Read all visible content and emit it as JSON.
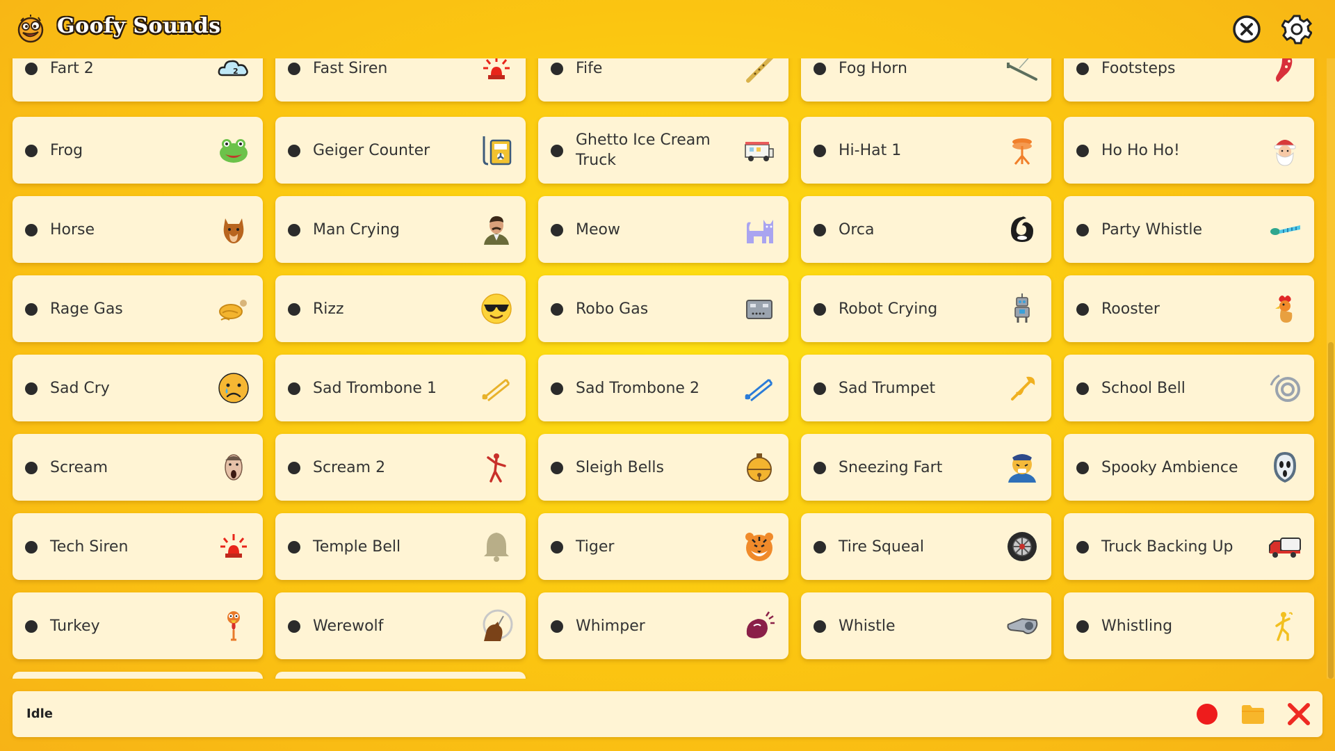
{
  "app": {
    "title": "Goofy Sounds"
  },
  "status": {
    "text": "Idle"
  },
  "sounds": [
    {
      "label": "Fart 2",
      "icon": "cloud-icon"
    },
    {
      "label": "Fast Siren",
      "icon": "siren-icon"
    },
    {
      "label": "Fife",
      "icon": "flute-icon"
    },
    {
      "label": "Fog Horn",
      "icon": "horn-icon"
    },
    {
      "label": "Footsteps",
      "icon": "footprint-icon"
    },
    {
      "label": "Frog",
      "icon": "frog-icon"
    },
    {
      "label": "Geiger Counter",
      "icon": "geiger-counter-icon"
    },
    {
      "label": "Ghetto Ice Cream Truck",
      "icon": "ice-cream-truck-icon"
    },
    {
      "label": "Hi-Hat 1",
      "icon": "hi-hat-icon"
    },
    {
      "label": "Ho Ho Ho!",
      "icon": "santa-icon"
    },
    {
      "label": "Horse",
      "icon": "horse-icon"
    },
    {
      "label": "Man Crying",
      "icon": "man-crying-icon"
    },
    {
      "label": "Meow",
      "icon": "cat-icon"
    },
    {
      "label": "Orca",
      "icon": "orca-icon"
    },
    {
      "label": "Party Whistle",
      "icon": "party-whistle-icon"
    },
    {
      "label": "Rage Gas",
      "icon": "rage-gas-icon"
    },
    {
      "label": "Rizz",
      "icon": "sunglasses-face-icon"
    },
    {
      "label": "Robo Gas",
      "icon": "robot-face-icon"
    },
    {
      "label": "Robot Crying",
      "icon": "robot-icon"
    },
    {
      "label": "Rooster",
      "icon": "rooster-icon"
    },
    {
      "label": "Sad Cry",
      "icon": "sad-face-icon"
    },
    {
      "label": "Sad Trombone 1",
      "icon": "trombone-icon"
    },
    {
      "label": "Sad Trombone 2",
      "icon": "trombone-blue-icon"
    },
    {
      "label": "Sad Trumpet",
      "icon": "trumpet-icon"
    },
    {
      "label": "School Bell",
      "icon": "bell-ring-icon"
    },
    {
      "label": "Scream",
      "icon": "screaming-face-icon"
    },
    {
      "label": "Scream 2",
      "icon": "scream-figure-icon"
    },
    {
      "label": "Sleigh Bells",
      "icon": "sleigh-bell-icon"
    },
    {
      "label": "Sneezing Fart",
      "icon": "sneezing-face-icon"
    },
    {
      "label": "Spooky Ambience",
      "icon": "ghost-mask-icon"
    },
    {
      "label": "Tech Siren",
      "icon": "tech-siren-icon"
    },
    {
      "label": "Temple Bell",
      "icon": "temple-bell-icon"
    },
    {
      "label": "Tiger",
      "icon": "tiger-icon"
    },
    {
      "label": "Tire Squeal",
      "icon": "tire-icon"
    },
    {
      "label": "Truck Backing Up",
      "icon": "truck-icon"
    },
    {
      "label": "Turkey",
      "icon": "turkey-icon"
    },
    {
      "label": "Werewolf",
      "icon": "werewolf-icon"
    },
    {
      "label": "Whimper",
      "icon": "whimper-icon"
    },
    {
      "label": "Whistle",
      "icon": "whistle-icon"
    },
    {
      "label": "Whistling",
      "icon": "whistling-person-icon"
    }
  ],
  "colors": {
    "background": "#fbc511",
    "card": "#fff4d4",
    "record": "#ee1c1c",
    "folder": "#f7b62b",
    "clear": "#ee2a22"
  }
}
